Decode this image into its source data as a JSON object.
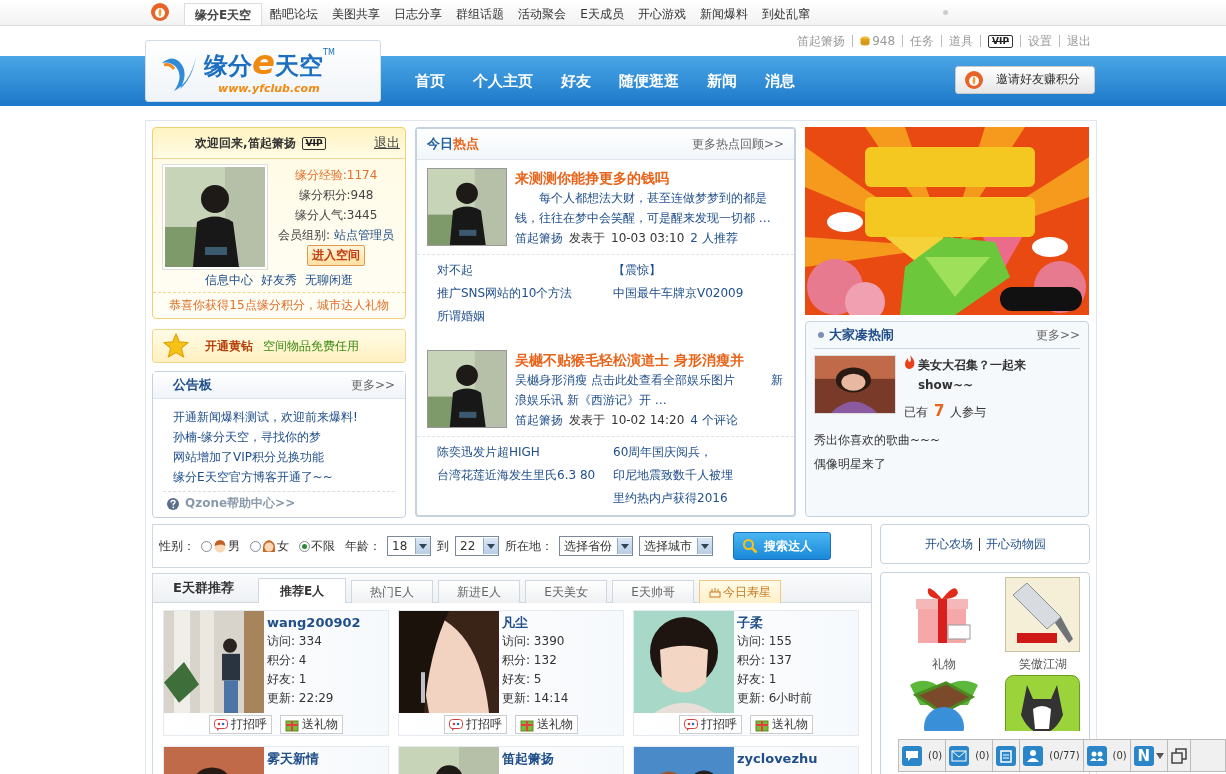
{
  "topnav": [
    {
      "label": "缘分E天空",
      "selected": true
    },
    {
      "label": "酷吧论坛",
      "selected": false
    },
    {
      "label": "美图共享",
      "selected": false
    },
    {
      "label": "日志分享",
      "selected": false
    },
    {
      "label": "群组话题",
      "selected": false
    },
    {
      "label": "活动聚会",
      "selected": false
    },
    {
      "label": "E天成员",
      "selected": false
    },
    {
      "label": "开心游戏",
      "selected": false
    },
    {
      "label": "新闻爆料",
      "selected": false
    },
    {
      "label": "到处乱窜",
      "selected": false
    }
  ],
  "user_links": [
    {
      "label": "笛起箫扬",
      "kind": "text"
    },
    {
      "label": "948",
      "kind": "coins"
    },
    {
      "label": "任务",
      "kind": "text"
    },
    {
      "label": "道具",
      "kind": "text"
    },
    {
      "label": "VIP",
      "kind": "vip"
    },
    {
      "label": "设置",
      "kind": "text"
    },
    {
      "label": "退出",
      "kind": "text"
    }
  ],
  "logo": {
    "part1": "缘分",
    "letter": "e",
    "part2": "天空",
    "tm": "TM",
    "url": "www.yfclub.com"
  },
  "mainnav": [
    "首页",
    "个人主页",
    "好友",
    "随便逛逛",
    "新闻",
    "消息"
  ],
  "invite_button": "邀请好友赚积分",
  "welcome": {
    "title": "欢迎回来,笛起箫扬",
    "vip": "VIP",
    "logout": "退出",
    "stats": [
      {
        "text": "缘分经验:1174",
        "kind": "highlight"
      },
      {
        "text": "缘分积分:948",
        "kind": "plain"
      },
      {
        "text": "缘分人气:3445",
        "kind": "plain"
      }
    ],
    "group_label": "会员组别:",
    "group": "站点管理员",
    "enter": "进入空间",
    "links": [
      "信息中心",
      "好友秀",
      "无聊闲逛"
    ],
    "notice": "恭喜你获得15点缘分积分，城市达人礼物"
  },
  "yellow_diamond": {
    "title": "开通黄钻",
    "text": "空间物品免费任用"
  },
  "board": {
    "title": "公告板",
    "more": "更多>>",
    "items": [
      "开通新闻爆料测试，欢迎前来爆料!",
      "孙楠-缘分天空，寻找你的梦",
      "网站增加了VIP积分兑换功能",
      "缘分E天空官方博客开通了~~"
    ],
    "help": "Qzone帮助中心>>"
  },
  "hot": {
    "title_a": "今日",
    "title_b": "热点",
    "more": "更多热点回顾>>",
    "sections": [
      {
        "headline": "来测测你能挣更多的钱吗",
        "summary": "　　每个人都想法大财，甚至连做梦梦到的都是钱，往往在梦中会笑醒，可是醒来发现一切都 …",
        "author": "笛起箫扬",
        "posted": "发表于",
        "time": "10-03 03:10",
        "stat": "2 人推荐",
        "left": [
          "对不起",
          "推广SNS网站的10个方法",
          "所谓婚姻"
        ],
        "right": [
          "【震惊】",
          "中国最牛车牌京V02009"
        ]
      },
      {
        "headline": "吴樾不贴猴毛轻松演道士 身形消瘦并",
        "summary": "吴樾身形消瘦 点击此处查看全部娱乐图片　　　新浪娱乐讯 新《西游记》开 …",
        "author": "笛起箫扬",
        "posted": "发表于",
        "time": "10-02 14:20",
        "stat": "4 个评论",
        "left": [
          "陈奕迅发片超HIGH",
          "台湾花莲近海发生里氏6.3 80"
        ],
        "right": [
          "60周年国庆阅兵，",
          "印尼地震致数千人被埋",
          "里约热内卢获得2016"
        ]
      }
    ]
  },
  "crowd": {
    "title": "大家凑热闹",
    "more": "更多>>",
    "feature": "美女大召集？一起来show~~",
    "joined_a": "已有",
    "count": "7",
    "joined_b": "人参与",
    "items": [
      "秀出你喜欢的歌曲~~~",
      "偶像明星来了"
    ]
  },
  "search": {
    "gender_label": "性别：",
    "genders": [
      {
        "label": "男",
        "kind": "male",
        "selected": false
      },
      {
        "label": "女",
        "kind": "female",
        "selected": false
      },
      {
        "label": "不限",
        "kind": "any",
        "selected": true
      }
    ],
    "age_label": "年龄：",
    "age_from": "18",
    "to": "到",
    "age_to": "22",
    "location_label": "所在地：",
    "province": "选择省份",
    "city": "选择城市",
    "button": "搜索达人"
  },
  "recommend": {
    "title": "E天群推荐",
    "tabs": [
      {
        "label": "推荐E人",
        "kind": "plain",
        "selected": true
      },
      {
        "label": "热门E人",
        "kind": "plain",
        "selected": false
      },
      {
        "label": "新进E人",
        "kind": "plain",
        "selected": false
      },
      {
        "label": "E天美女",
        "kind": "plain",
        "selected": false
      },
      {
        "label": "E天帅哥",
        "kind": "plain",
        "selected": false
      },
      {
        "label": "今日寿星",
        "kind": "birthday",
        "selected": false
      }
    ],
    "people": [
      {
        "name": "wang200902",
        "stats": [
          "访问: 334",
          "积分: 4",
          "好友: 1",
          "更新: 22:29"
        ],
        "greet": "打招呼",
        "gift": "送礼物"
      },
      {
        "name": "凡尘",
        "stats": [
          "访问: 3390",
          "积分: 132",
          "好友: 5",
          "更新: 14:14"
        ],
        "greet": "打招呼",
        "gift": "送礼物"
      },
      {
        "name": "子柔",
        "stats": [
          "访问: 155",
          "积分: 137",
          "好友: 1",
          "更新: 6小时前"
        ],
        "greet": "打招呼",
        "gift": "送礼物"
      },
      {
        "name": "雾天新情"
      },
      {
        "name": "笛起箫扬"
      },
      {
        "name": "zyclovezhu"
      }
    ]
  },
  "apps_links": [
    "开心农场",
    "开心动物园"
  ],
  "apps": [
    {
      "label": "礼物",
      "kind": "gift"
    },
    {
      "label": "笑傲江湖",
      "kind": "knife"
    },
    {
      "kind": "farm"
    },
    {
      "kind": "dog"
    }
  ],
  "toolbar": [
    {
      "kind": "chat",
      "count": "(0)"
    },
    {
      "kind": "mail",
      "count": "(0)"
    },
    {
      "kind": "note"
    },
    {
      "kind": "friend",
      "count": "(0/77)"
    },
    {
      "kind": "group",
      "count": "(0)"
    },
    {
      "kind": "app",
      "label": "N"
    },
    {
      "kind": "restore"
    }
  ]
}
